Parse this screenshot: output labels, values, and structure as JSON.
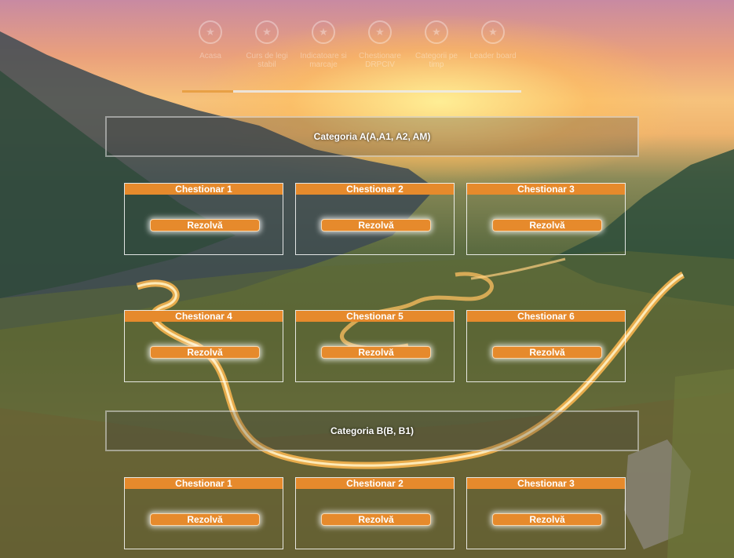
{
  "nav": {
    "steps": [
      {
        "label": "Acasa",
        "active": true,
        "icon": "star-icon"
      },
      {
        "label": "Curs de legi stabil",
        "active": false,
        "icon": "star-icon"
      },
      {
        "label": "Indicatoare si marcaje",
        "active": false,
        "icon": "star-icon"
      },
      {
        "label": "Chestionare DRPCIV",
        "active": false,
        "icon": "star-icon"
      },
      {
        "label": "Categorii pe timp",
        "active": false,
        "icon": "star-icon"
      },
      {
        "label": "Leader board",
        "active": false,
        "icon": "star-icon"
      }
    ],
    "progress_fraction": 0.15
  },
  "categories": [
    {
      "title": "Categoria A(A,A1, A2, AM)",
      "quizzes": [
        {
          "title": "Chestionar 1",
          "button": "Rezolvă"
        },
        {
          "title": "Chestionar 2",
          "button": "Rezolvă"
        },
        {
          "title": "Chestionar 3",
          "button": "Rezolvă"
        },
        {
          "title": "Chestionar 4",
          "button": "Rezolvă"
        },
        {
          "title": "Chestionar 5",
          "button": "Rezolvă"
        },
        {
          "title": "Chestionar 6",
          "button": "Rezolvă"
        }
      ]
    },
    {
      "title": "Categoria B(B, B1)",
      "quizzes": [
        {
          "title": "Chestionar 1",
          "button": "Rezolvă"
        },
        {
          "title": "Chestionar 2",
          "button": "Rezolvă"
        },
        {
          "title": "Chestionar 3",
          "button": "Rezolvă"
        }
      ]
    }
  ],
  "colors": {
    "accent": "#e68a2c",
    "progress": "#e8a045",
    "card_border": "#ffffff"
  }
}
